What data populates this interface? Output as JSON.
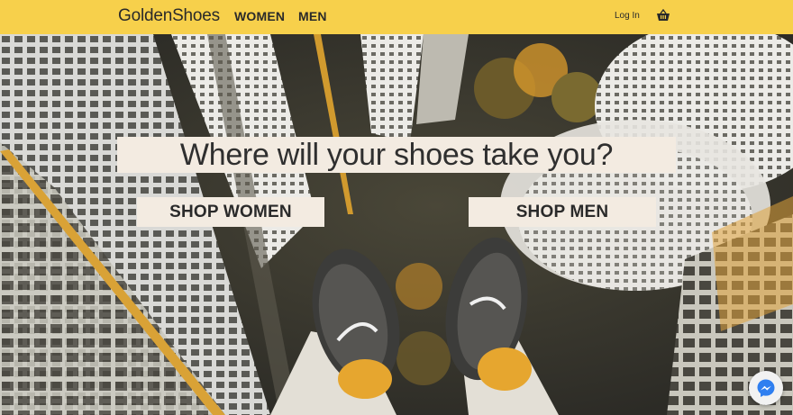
{
  "brand": "GoldenShoes",
  "nav": {
    "women": "WOMEN",
    "men": "MEN",
    "login": "Log In",
    "cart_icon": "shopping-basket-icon"
  },
  "hero": {
    "headline": "Where will your shoes take you?",
    "shop_women": "SHOP WOMEN",
    "shop_men": "SHOP MEN"
  },
  "chat": {
    "icon": "messenger-icon"
  },
  "colors": {
    "navbar": "#f7d04b",
    "button_bg": "#f3ebe1",
    "text": "#2a2a2a"
  }
}
